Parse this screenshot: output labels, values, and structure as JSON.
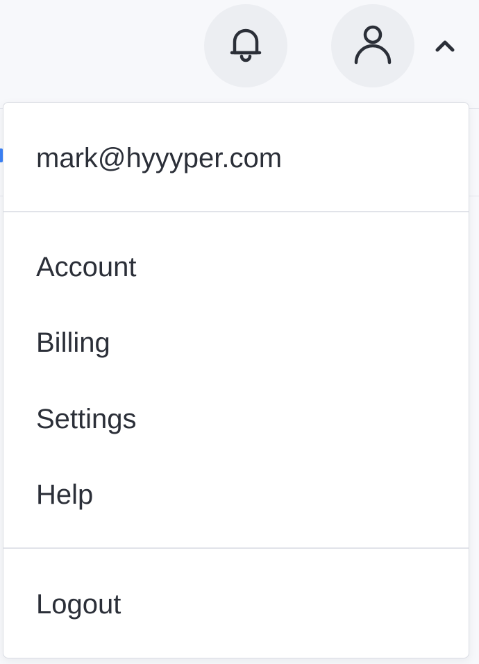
{
  "header": {
    "notifications_icon": "bell-icon",
    "user_icon": "user-icon",
    "menu_toggle_icon": "chevron-up-icon"
  },
  "dropdown": {
    "email": "mark@hyyyper.com",
    "items": [
      {
        "label": "Account"
      },
      {
        "label": "Billing"
      },
      {
        "label": "Settings"
      },
      {
        "label": "Help"
      }
    ],
    "logout_label": "Logout"
  },
  "colors": {
    "background": "#f7f8fb",
    "icon_button_bg": "#eceef2",
    "menu_bg": "#ffffff",
    "text": "#2b2f38",
    "divider": "#e1e3e9",
    "accent": "#3b82f6"
  }
}
